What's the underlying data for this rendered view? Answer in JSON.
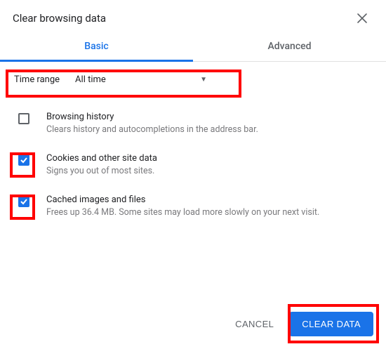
{
  "dialog": {
    "title": "Clear browsing data"
  },
  "tabs": {
    "basic": "Basic",
    "advanced": "Advanced"
  },
  "time": {
    "label": "Time range",
    "value": "All time"
  },
  "options": {
    "history": {
      "title": "Browsing history",
      "desc": "Clears history and autocompletions in the address bar.",
      "checked": false
    },
    "cookies": {
      "title": "Cookies and other site data",
      "desc": "Signs you out of most sites.",
      "checked": true
    },
    "cache": {
      "title": "Cached images and files",
      "desc": "Frees up 36.4 MB. Some sites may load more slowly on your next visit.",
      "checked": true
    }
  },
  "actions": {
    "cancel": "CANCEL",
    "clear": "CLEAR DATA"
  }
}
